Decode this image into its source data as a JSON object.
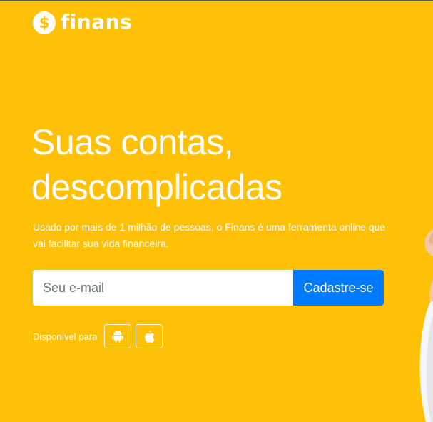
{
  "brand": {
    "logo_symbol": "$",
    "name": "finans"
  },
  "hero": {
    "headline_line1": "Suas contas,",
    "headline_line2": "descomplicadas",
    "subtitle": "Usado por mais de 1 milhão de pessoas, o Finans é uma ferramenta online que vai facilitar sua vida financeira."
  },
  "signup": {
    "email_placeholder": "Seu e-mail",
    "email_value": "",
    "button_label": "Cadastre-se"
  },
  "platforms": {
    "label": "Disponível para",
    "items": [
      {
        "icon": "android-icon"
      },
      {
        "icon": "apple-icon"
      }
    ]
  },
  "colors": {
    "background": "#FFC107",
    "primary_button": "#007BFF",
    "text": "#FFFFFF"
  }
}
